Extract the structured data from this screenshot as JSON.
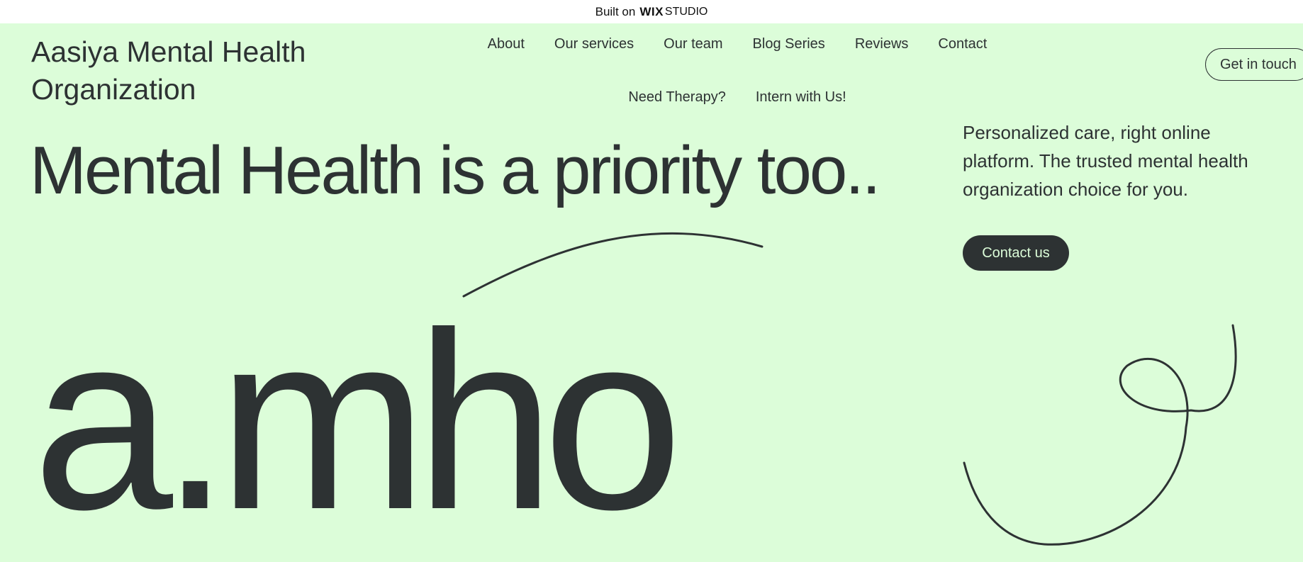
{
  "wix_banner": {
    "built_on": "Built on",
    "wix": "WIX",
    "studio": "STUDIO"
  },
  "header": {
    "site_title": "Aasiya Mental Health Organization",
    "nav": [
      "About",
      "Our services",
      "Our team",
      "Blog Series",
      "Reviews",
      "Contact",
      "Need Therapy?",
      "Intern with Us!"
    ],
    "cta": "Get in touch"
  },
  "hero": {
    "heading": "Mental Health is a priority too..",
    "tagline": "Personalized care, right online platform. The trusted mental health organization choice for you.",
    "contact_button": "Contact us",
    "logo_text": "a.mho"
  },
  "colors": {
    "background": "#dcfdd9",
    "text": "#2d3233",
    "button_bg": "#2d3233",
    "button_text": "#dcfdd9"
  }
}
